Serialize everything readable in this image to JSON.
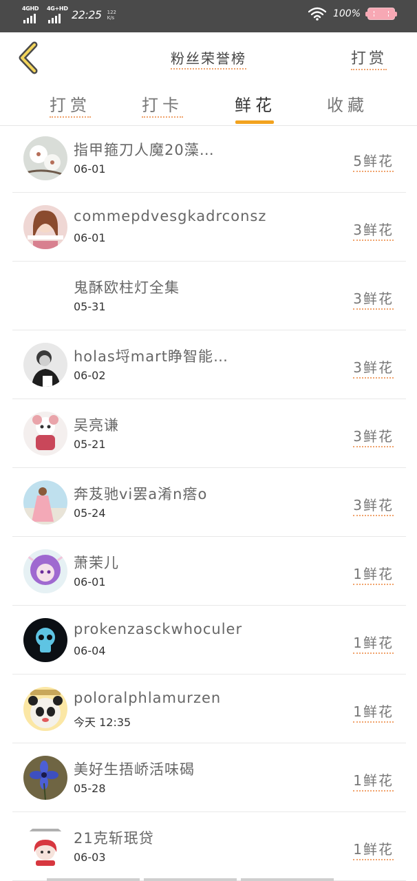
{
  "status_bar": {
    "net1": "4GHD",
    "net2": "4G+HD",
    "time": "22:25",
    "speed": "122\nK/s",
    "battery": "100%"
  },
  "header": {
    "title": "粉丝荣誉榜",
    "action": "打赏"
  },
  "tabs": [
    {
      "label": "打赏"
    },
    {
      "label": "打卡"
    },
    {
      "label": "鲜花"
    },
    {
      "label": "收藏"
    }
  ],
  "active_tab": 2,
  "colors": {
    "accent": "#f2a31f",
    "status_bar": "#4a4a4a"
  },
  "items": [
    {
      "name": "指甲箍刀人魔20藻…",
      "date": "06-01",
      "count": "5鲜花",
      "avatar": "flower-white"
    },
    {
      "name": "commepdvesgkadrconsz",
      "date": "06-01",
      "count": "3鲜花",
      "avatar": "girl-pink"
    },
    {
      "name": "鬼酥欧柱灯全集",
      "date": "05-31",
      "count": "3鲜花",
      "avatar": "none"
    },
    {
      "name": "holas埒mart睁智能…",
      "date": "06-02",
      "count": "3鲜花",
      "avatar": "person-bw"
    },
    {
      "name": "吴亮谦",
      "date": "05-21",
      "count": "3鲜花",
      "avatar": "doll"
    },
    {
      "name": "奔芨驰vi罢a淆n瘩o",
      "date": "05-24",
      "count": "3鲜花",
      "avatar": "girl-beach"
    },
    {
      "name": "萧茉儿",
      "date": "06-01",
      "count": "1鲜花",
      "avatar": "anime-purple"
    },
    {
      "name": "prokenzasckwhoculer",
      "date": "06-04",
      "count": "1鲜花",
      "avatar": "skull-dark"
    },
    {
      "name": "poloralphlamurzen",
      "date": "今天 12:35",
      "count": "1鲜花",
      "avatar": "panda"
    },
    {
      "name": "美好生捂峤活味碣",
      "date": "05-28",
      "count": "1鲜花",
      "avatar": "blue-flower"
    },
    {
      "name": "21克斩珉贷",
      "date": "06-03",
      "count": "1鲜花",
      "avatar": "cartoon-red"
    }
  ]
}
